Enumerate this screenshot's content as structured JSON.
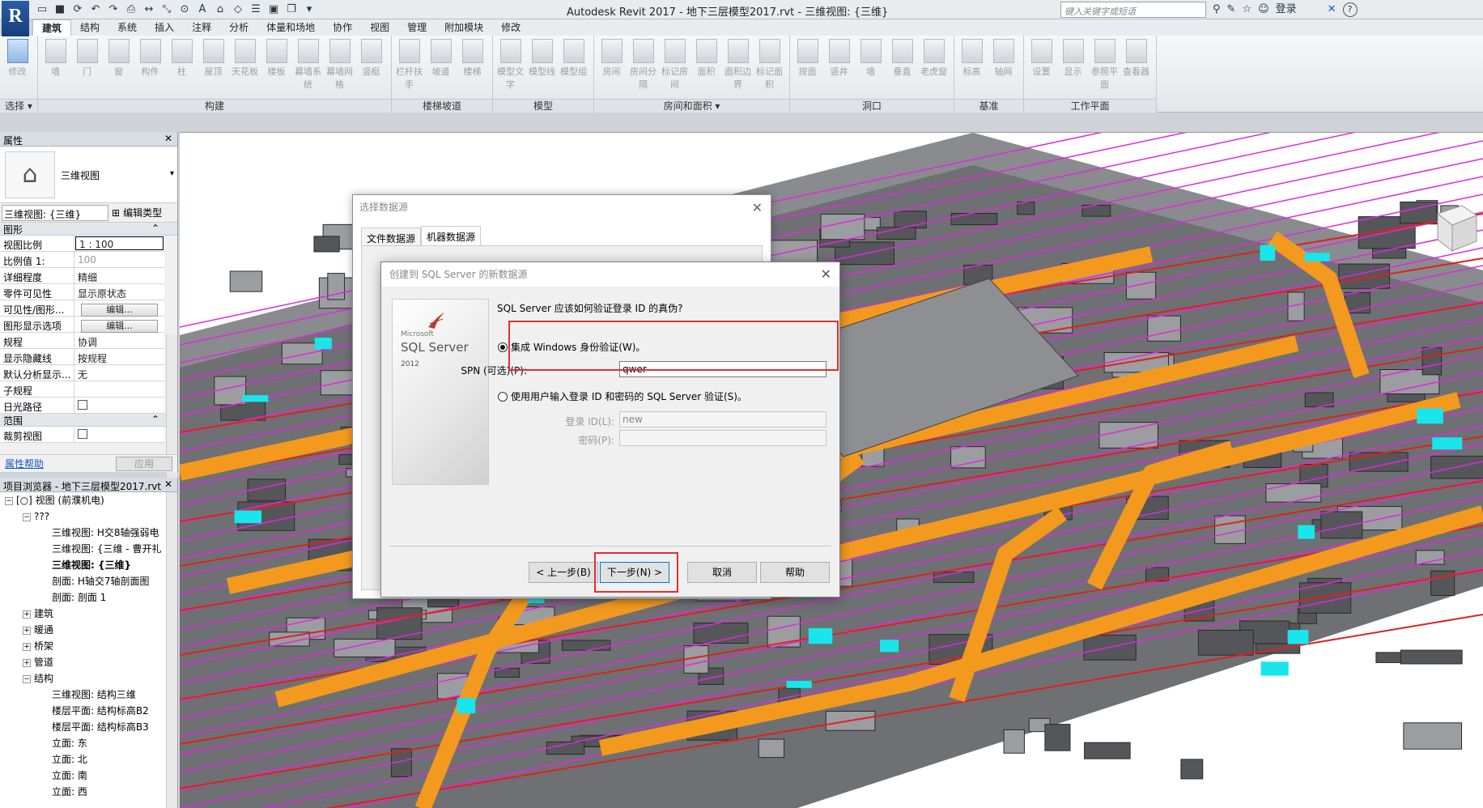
{
  "titlebar": {
    "logo": "R",
    "title": "Autodesk Revit 2017 -    地下三层模型2017.rvt - 三维视图: {三维}",
    "search_placeholder": "键入关键字或短语",
    "login": "登录",
    "help": "?"
  },
  "ribbon": {
    "tabs": [
      "建筑",
      "结构",
      "系统",
      "插入",
      "注释",
      "分析",
      "体量和场地",
      "协作",
      "视图",
      "管理",
      "附加模块",
      "修改"
    ],
    "panels": [
      {
        "title": "选择 ▾",
        "tools": [
          "修改"
        ]
      },
      {
        "title": "构建",
        "tools": [
          "墙",
          "门",
          "窗",
          "构件",
          "柱",
          "屋顶",
          "天花板",
          "楼板",
          "幕墙系统",
          "幕墙网格",
          "竖梃"
        ]
      },
      {
        "title": "楼梯坡道",
        "tools": [
          "栏杆扶手",
          "坡道",
          "楼梯"
        ]
      },
      {
        "title": "模型",
        "tools": [
          "模型文字",
          "模型线",
          "模型组"
        ]
      },
      {
        "title": "房间和面积 ▾",
        "tools": [
          "房间",
          "房间分隔",
          "标记房间",
          "面积",
          "面积边界",
          "标记面积"
        ]
      },
      {
        "title": "洞口",
        "tools": [
          "按面",
          "竖井",
          "墙",
          "垂直",
          "老虎窗"
        ]
      },
      {
        "title": "基准",
        "tools": [
          "标高",
          "轴网"
        ]
      },
      {
        "title": "工作平面",
        "tools": [
          "设置",
          "显示",
          "参照平面",
          "查看器"
        ]
      }
    ]
  },
  "properties": {
    "header": "属性",
    "type_name": "三维视图",
    "view_select": "三维视图: {三维}",
    "edit_type": "编辑类型",
    "group_graphics": "图形",
    "rows": [
      {
        "k": "视图比例",
        "v": "1 : 100"
      },
      {
        "k": "比例值 1:",
        "v": "100"
      },
      {
        "k": "详细程度",
        "v": "精细"
      },
      {
        "k": "零件可见性",
        "v": "显示原状态"
      },
      {
        "k": "可见性/图形...",
        "v": "编辑..."
      },
      {
        "k": "图形显示选项",
        "v": "编辑..."
      },
      {
        "k": "规程",
        "v": "协调"
      },
      {
        "k": "显示隐藏线",
        "v": "按规程"
      },
      {
        "k": "默认分析显示...",
        "v": "无"
      },
      {
        "k": "子规程",
        "v": ""
      },
      {
        "k": "日光路径",
        "v": ""
      }
    ],
    "group_extent": "范围",
    "crop_row": "裁剪视图",
    "help_link": "属性帮助",
    "apply": "应用"
  },
  "browser": {
    "header": "项目浏览器 - 地下三层模型2017.rvt",
    "items": [
      {
        "t": "[○] 视图 (前濮机电)",
        "lvl": 0,
        "exp": "−"
      },
      {
        "t": "???",
        "lvl": 1,
        "exp": "−"
      },
      {
        "t": "三维视图: H交8轴强弱电",
        "lvl": 2
      },
      {
        "t": "三维视图: {三维 - 曹开礼",
        "lvl": 2
      },
      {
        "t": "三维视图: {三维}",
        "lvl": 2,
        "bold": true
      },
      {
        "t": "剖面: H轴交7轴剖面图",
        "lvl": 2
      },
      {
        "t": "剖面: 剖面 1",
        "lvl": 2
      },
      {
        "t": "建筑",
        "lvl": 1,
        "exp": "+"
      },
      {
        "t": "暖通",
        "lvl": 1,
        "exp": "+"
      },
      {
        "t": "桥架",
        "lvl": 1,
        "exp": "+"
      },
      {
        "t": "管道",
        "lvl": 1,
        "exp": "+"
      },
      {
        "t": "结构",
        "lvl": 1,
        "exp": "−"
      },
      {
        "t": "三维视图: 结构三维",
        "lvl": 2
      },
      {
        "t": "楼层平面: 结构标高B2",
        "lvl": 2
      },
      {
        "t": "楼层平面: 结构标高B3",
        "lvl": 2
      },
      {
        "t": "立面: 东",
        "lvl": 2
      },
      {
        "t": "立面: 北",
        "lvl": 2
      },
      {
        "t": "立面: 南",
        "lvl": 2
      },
      {
        "t": "立面: 西",
        "lvl": 2
      }
    ]
  },
  "dialog_back": {
    "title": "选择数据源",
    "tabs": [
      "文件数据源",
      "机器数据源"
    ]
  },
  "dialog_front": {
    "title": "创建到 SQL Server 的新数据源",
    "logo_ms": "Microsoft",
    "logo_sql": "SQL Server",
    "logo_year": "2012",
    "question": "SQL Server 应该如何验证登录 ID 的真伪?",
    "radio_windows": "集成 Windows 身份验证(W)。",
    "spn_label": "SPN (可选)(P):",
    "spn_value": "qwer",
    "radio_sql": "使用用户输入登录 ID 和密码的 SQL Server 验证(S)。",
    "login_label": "登录 ID(L):",
    "login_value": "new",
    "password_label": "密码(P):",
    "password_value": "",
    "btn_back": "< 上一步(B)",
    "btn_next": "下一步(N) >",
    "btn_cancel": "取消",
    "btn_help": "帮助"
  },
  "colors": {
    "duct": "#f39a1e",
    "pipe_cyan": "#18e6ec",
    "pipe_magenta": "#e028e0",
    "pipe_red": "#e02020",
    "highlight": "#e03030"
  }
}
